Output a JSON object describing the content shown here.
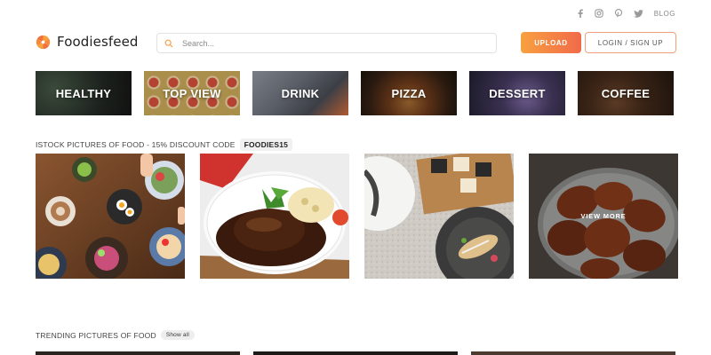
{
  "social": {
    "icons": [
      "facebook-icon",
      "instagram-icon",
      "pinterest-icon",
      "twitter-icon"
    ],
    "blog_label": "BLOG"
  },
  "header": {
    "logo_text": "Foodiesfeed",
    "search_placeholder": "Search...",
    "upload_label": "UPLOAD",
    "login_label": "LOGIN / SIGN UP",
    "accent_color": "#f47c48"
  },
  "categories": [
    {
      "label": "HEALTHY"
    },
    {
      "label": "TOP VIEW"
    },
    {
      "label": "DRINK"
    },
    {
      "label": "PIZZA"
    },
    {
      "label": "DESSERT"
    },
    {
      "label": "COFFEE"
    }
  ],
  "istock": {
    "heading": "ISTOCK PICTURES OF FOOD - 15% DISCOUNT CODE",
    "code": "FOODIES15",
    "view_more": "VIEW MORE"
  },
  "trending": {
    "heading": "TRENDING PICTURES OF FOOD",
    "show_all": "Show all"
  }
}
